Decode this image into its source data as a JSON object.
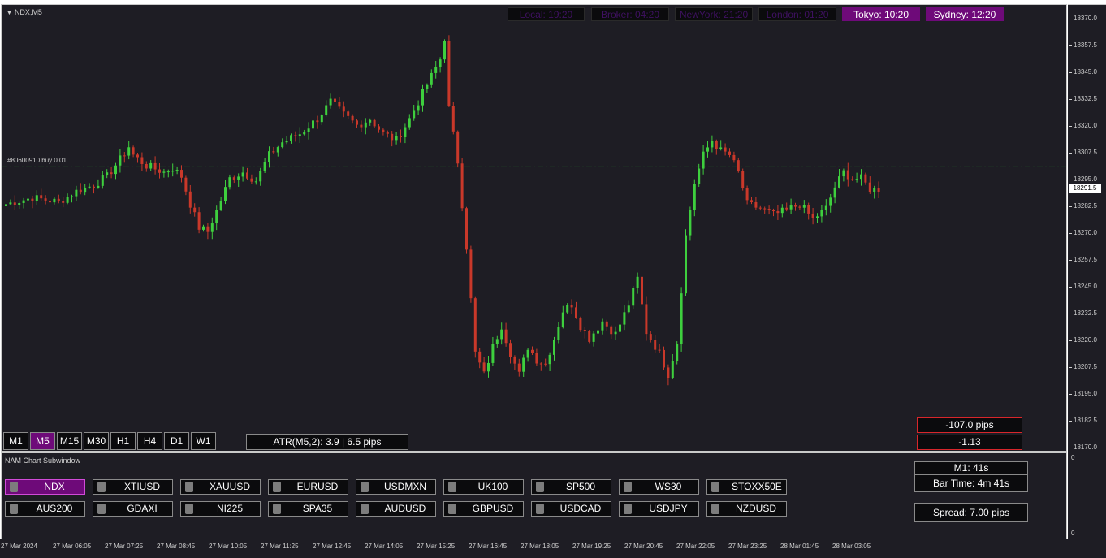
{
  "chart": {
    "symbol_label": "NDX,M5",
    "order_line_label": "#80600910 buy 0.01",
    "current_price": "18291.5",
    "price_ticks": [
      "18370.0",
      "18357.5",
      "18345.0",
      "18332.5",
      "18320.0",
      "18307.5",
      "18295.0",
      "18282.5",
      "18270.0",
      "18257.5",
      "18245.0",
      "18232.5",
      "18220.0",
      "18207.5",
      "18195.0",
      "18182.5",
      "18170.0"
    ],
    "colors": {
      "background": "#1e1d24",
      "bull": "#3ecf3e",
      "bear": "#c9382a",
      "order_line": "#1f7a2a",
      "accent": "#6e0a79"
    }
  },
  "chart_data": {
    "type": "candlestick",
    "ylim": [
      18170.0,
      18372.0
    ],
    "order_price": 18302.5,
    "x_labels": [
      "27 Mar 2024",
      "27 Mar 06:05",
      "27 Mar 07:25",
      "27 Mar 08:45",
      "27 Mar 10:05",
      "27 Mar 11:25",
      "27 Mar 12:45",
      "27 Mar 14:05",
      "27 Mar 15:25",
      "27 Mar 16:45",
      "27 Mar 18:05",
      "27 Mar 19:25",
      "27 Mar 20:45",
      "27 Mar 22:05",
      "27 Mar 23:25",
      "28 Mar 01:45",
      "28 Mar 03:05"
    ],
    "close_path": [
      [
        0,
        18285
      ],
      [
        6,
        18288
      ],
      [
        12,
        18286
      ],
      [
        16,
        18291
      ],
      [
        20,
        18294
      ],
      [
        23,
        18298
      ],
      [
        26,
        18306
      ],
      [
        28,
        18312
      ],
      [
        29,
        18308
      ],
      [
        32,
        18303
      ],
      [
        36,
        18300
      ],
      [
        38,
        18302
      ],
      [
        40,
        18298
      ],
      [
        42,
        18285
      ],
      [
        44,
        18274
      ],
      [
        46,
        18272
      ],
      [
        48,
        18282
      ],
      [
        51,
        18297
      ],
      [
        54,
        18300
      ],
      [
        57,
        18296
      ],
      [
        60,
        18308
      ],
      [
        63,
        18314
      ],
      [
        67,
        18318
      ],
      [
        71,
        18325
      ],
      [
        74,
        18333
      ],
      [
        77,
        18327
      ],
      [
        80,
        18322
      ],
      [
        83,
        18325
      ],
      [
        86,
        18318
      ],
      [
        89,
        18315
      ],
      [
        92,
        18325
      ],
      [
        95,
        18337
      ],
      [
        97,
        18345
      ],
      [
        99,
        18353
      ],
      [
        100,
        18363
      ],
      [
        101,
        18330
      ],
      [
        103,
        18305
      ],
      [
        105,
        18265
      ],
      [
        107,
        18215
      ],
      [
        109,
        18205
      ],
      [
        111,
        18218
      ],
      [
        113,
        18228
      ],
      [
        115,
        18215
      ],
      [
        117,
        18205
      ],
      [
        119,
        18218
      ],
      [
        121,
        18212
      ],
      [
        123,
        18210
      ],
      [
        125,
        18222
      ],
      [
        127,
        18235
      ],
      [
        129,
        18238
      ],
      [
        131,
        18228
      ],
      [
        133,
        18222
      ],
      [
        136,
        18230
      ],
      [
        139,
        18224
      ],
      [
        142,
        18238
      ],
      [
        144,
        18250
      ],
      [
        146,
        18225
      ],
      [
        149,
        18215
      ],
      [
        151,
        18205
      ],
      [
        153,
        18220
      ],
      [
        155,
        18270
      ],
      [
        157,
        18295
      ],
      [
        159,
        18308
      ],
      [
        161,
        18315
      ],
      [
        163,
        18310
      ],
      [
        165,
        18308
      ],
      [
        167,
        18300
      ],
      [
        169,
        18285
      ],
      [
        172,
        18283
      ],
      [
        175,
        18280
      ],
      [
        178,
        18282
      ],
      [
        181,
        18285
      ],
      [
        184,
        18278
      ],
      [
        187,
        18283
      ],
      [
        189,
        18293
      ],
      [
        191,
        18300
      ],
      [
        193,
        18297
      ],
      [
        195,
        18297
      ],
      [
        197,
        18292
      ],
      [
        199,
        18292
      ]
    ]
  },
  "clocks": [
    {
      "label": "Local: 19:20",
      "active": false
    },
    {
      "label": "Broker: 04:20",
      "active": false
    },
    {
      "label": "NewYork: 21:20",
      "active": false
    },
    {
      "label": "London: 01:20",
      "active": false
    },
    {
      "label": "Tokyo: 10:20",
      "active": true
    },
    {
      "label": "Sydney: 12:20",
      "active": true
    }
  ],
  "timeframes": [
    {
      "label": "M1",
      "active": false
    },
    {
      "label": "M5",
      "active": true
    },
    {
      "label": "M15",
      "active": false
    },
    {
      "label": "M30",
      "active": false
    },
    {
      "label": "H1",
      "active": false
    },
    {
      "label": "H4",
      "active": false
    },
    {
      "label": "D1",
      "active": false
    },
    {
      "label": "W1",
      "active": false
    }
  ],
  "atr_text": "ATR(M5,2): 3.9  |  6.5 pips",
  "pnl": {
    "pips": "-107.0 pips",
    "money": "-1.13"
  },
  "subwindow": {
    "title": "NAM Chart Subwindow",
    "axis_ticks": [
      "0",
      "0"
    ],
    "symbols_row1": [
      {
        "label": "NDX",
        "active": true
      },
      {
        "label": "XTIUSD",
        "active": false
      },
      {
        "label": "XAUUSD",
        "active": false
      },
      {
        "label": "EURUSD",
        "active": false
      },
      {
        "label": "USDMXN",
        "active": false
      },
      {
        "label": "UK100",
        "active": false
      },
      {
        "label": "SP500",
        "active": false
      },
      {
        "label": "WS30",
        "active": false
      },
      {
        "label": "STOXX50E",
        "active": false
      }
    ],
    "symbols_row2": [
      {
        "label": "AUS200",
        "active": false
      },
      {
        "label": "GDAXI",
        "active": false
      },
      {
        "label": "NI225",
        "active": false
      },
      {
        "label": "SPA35",
        "active": false
      },
      {
        "label": "AUDUSD",
        "active": false
      },
      {
        "label": "GBPUSD",
        "active": false
      },
      {
        "label": "USDCAD",
        "active": false
      },
      {
        "label": "USDJPY",
        "active": false
      },
      {
        "label": "NZDUSD",
        "active": false
      }
    ],
    "bar_info": {
      "m1": "M1:  41s",
      "bar_time": "Bar Time: 4m 41s",
      "spread": "Spread: 7.00 pips"
    }
  }
}
